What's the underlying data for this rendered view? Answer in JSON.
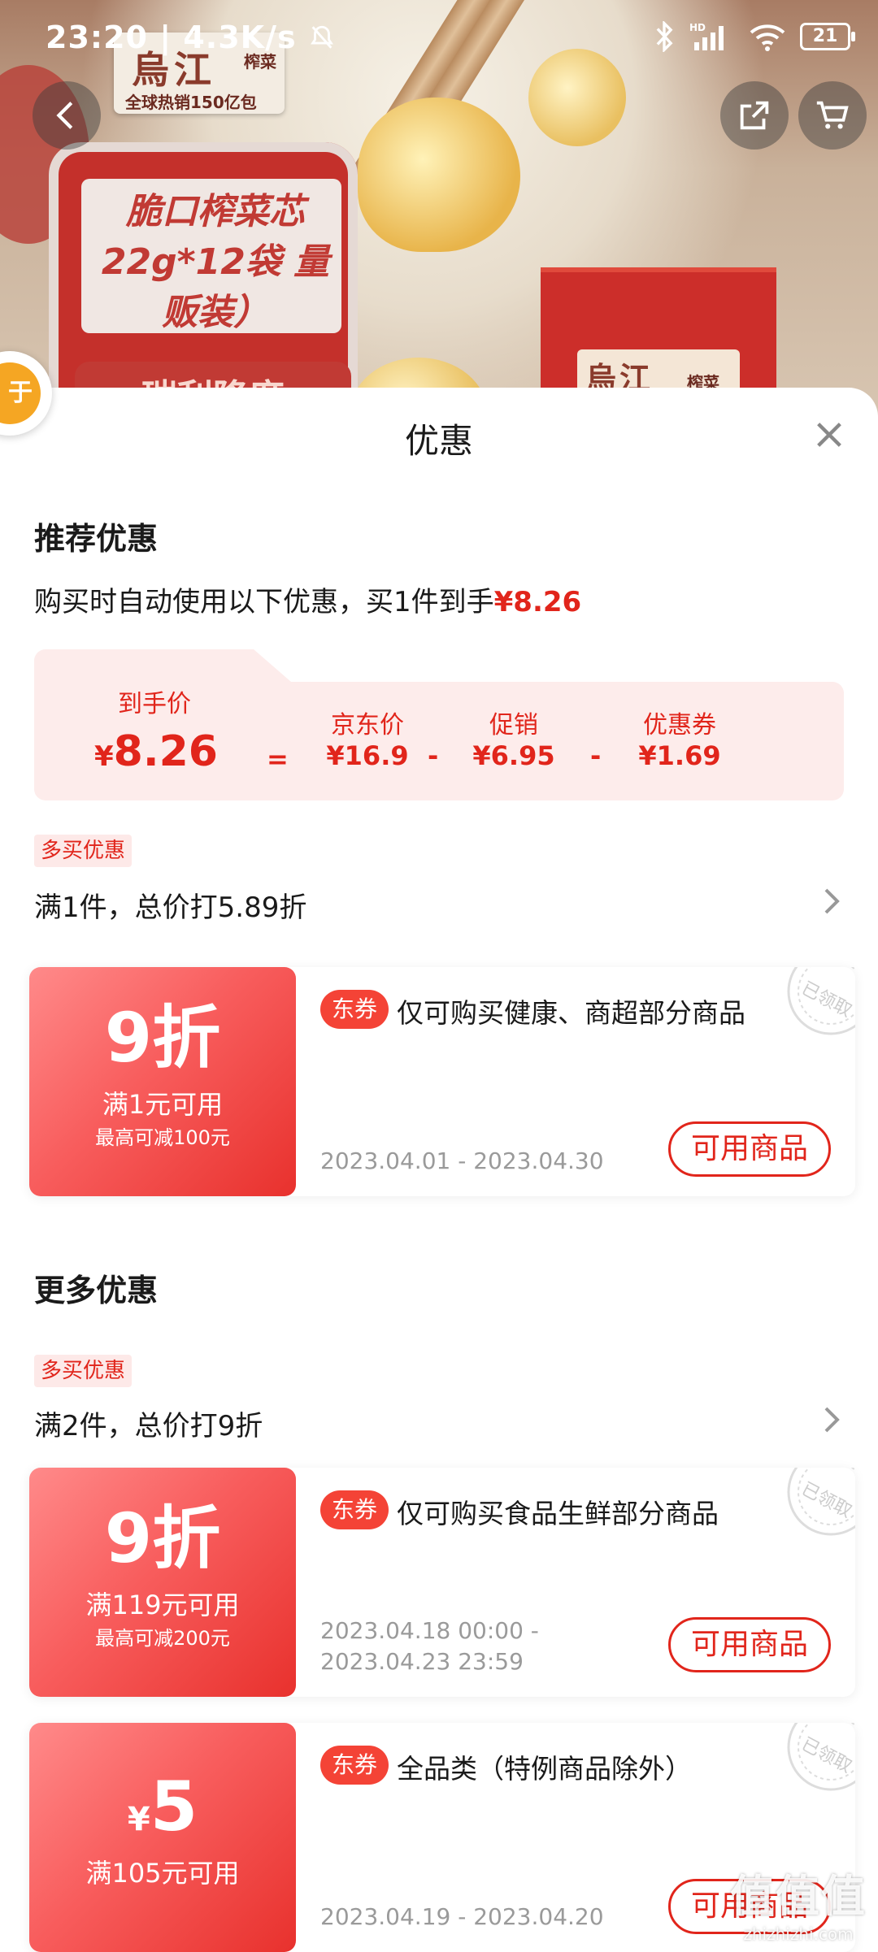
{
  "status_bar": {
    "time": "23:20",
    "network_speed": "4.3K/s",
    "battery": "21",
    "icons": [
      "mute-icon",
      "bluetooth-icon",
      "hd-signal-icon",
      "wifi-icon",
      "battery-icon"
    ]
  },
  "product_image": {
    "brand_name": "烏江",
    "brand_tag": "榨菜",
    "brand_sub": "全球热销150亿包",
    "pack_text": "脆口榨菜芯 22g*12袋 量贩装）",
    "pack_bottom": "瑞利降度"
  },
  "nav": {
    "icons": [
      "back-icon",
      "share-icon",
      "cart-icon"
    ]
  },
  "side_badge": {
    "text": "于"
  },
  "sheet": {
    "title": "优惠",
    "close_icon": "close-icon"
  },
  "recommended": {
    "title": "推荐优惠",
    "desc_prefix": "购买时自动使用以下优惠，买1件到手",
    "desc_price": "¥8.26",
    "breakdown": {
      "final_label": "到手价",
      "final_currency": "¥",
      "final_value": "8.26",
      "eq": "=",
      "jd_label": "京东价",
      "jd_value": "¥16.9",
      "minus1": "-",
      "promo_label": "促销",
      "promo_value": "¥6.95",
      "minus2": "-",
      "coupon_label": "优惠券",
      "coupon_value": "¥1.69"
    },
    "multi_tag": "多买优惠",
    "multi_rule": "满1件，总价打5.89折",
    "coupon": {
      "value": "9折",
      "condition": "满1元可用",
      "max": "最高可减100元",
      "badge": "东券",
      "text": "仅可购买健康、商超部分商品",
      "date": "2023.04.01 - 2023.04.30",
      "button": "可用商品",
      "stamp": "已领取"
    }
  },
  "more": {
    "title": "更多优惠",
    "multi_tag": "多买优惠",
    "multi_rule": "满2件，总价打9折",
    "coupons": [
      {
        "value": "9折",
        "condition": "满119元可用",
        "max": "最高可减200元",
        "badge": "东券",
        "text": "仅可购买食品生鲜部分商品",
        "date_line1": "2023.04.18 00:00 -",
        "date_line2": "2023.04.23 23:59",
        "button": "可用商品",
        "stamp": "已领取"
      },
      {
        "currency": "¥",
        "value": "5",
        "condition": "满105元可用",
        "badge": "东券",
        "text": "全品类（特例商品除外）",
        "date": "2023.04.19 - 2023.04.20",
        "button": "可用商品",
        "stamp": "已领取"
      }
    ]
  },
  "watermark": {
    "line1": "值值值",
    "line2": "zhizhizhi.com"
  },
  "colors": {
    "accent": "#e1251b",
    "tag_bg": "#fde9e8",
    "card_bg": "#fdeceb"
  }
}
